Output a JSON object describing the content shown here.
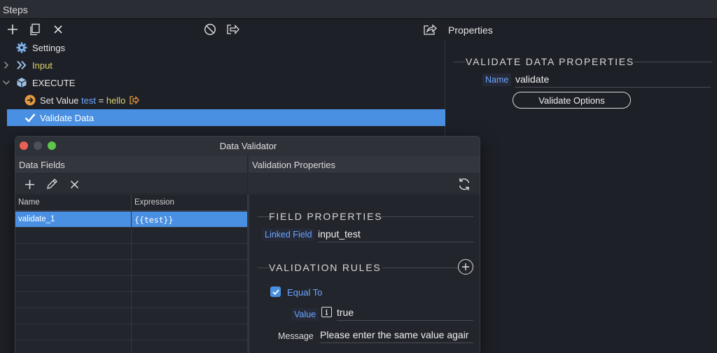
{
  "titlebar": {
    "title": "Steps"
  },
  "toolbar": {
    "properties_title": "Properties"
  },
  "steps": [
    {
      "label": "Settings"
    },
    {
      "label": "Input"
    },
    {
      "label": "EXECUTE"
    },
    {
      "label_prefix": "Set Value",
      "var": "test",
      "eq": "=",
      "val": "hello"
    },
    {
      "label": "Validate Data"
    }
  ],
  "props": {
    "section_title": "VALIDATE DATA PROPERTIES",
    "name_label": "Name",
    "name_value": "validate",
    "options_button": "Validate Options"
  },
  "dialog": {
    "title": "Data Validator",
    "col_fields": "Data Fields",
    "col_props": "Validation Properties",
    "grid_headers": [
      "Name",
      "Expression"
    ],
    "rows": [
      {
        "name": "validate_1",
        "expression": "{{test}}"
      }
    ],
    "field_section": "FIELD PROPERTIES",
    "linked_label": "Linked Field",
    "linked_value": "input_test",
    "rules_section": "VALIDATION RULES",
    "rule_label": "Equal To",
    "value_label": "Value",
    "value_value": "true",
    "message_label": "Message",
    "message_value": "Please enter the same value agair"
  },
  "colors": {
    "accent": "#4a90e2",
    "bg": "#1e2028",
    "link": "#6aa7ff"
  }
}
